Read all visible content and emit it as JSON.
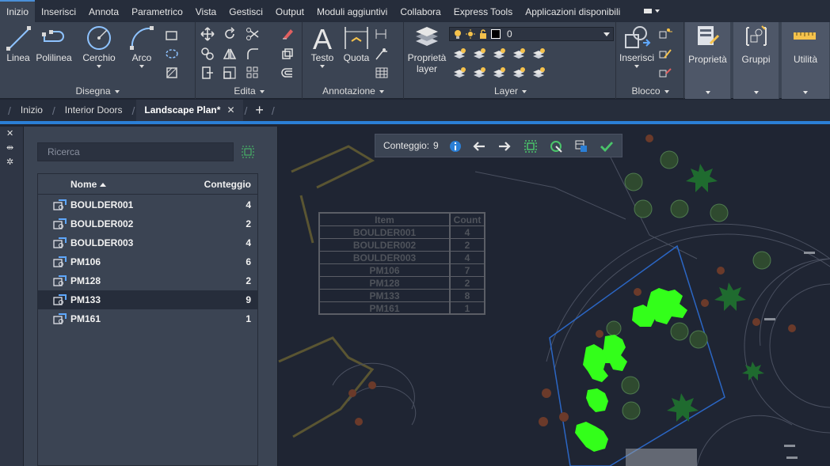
{
  "ribbon_tabs": [
    "Inizio",
    "Inserisci",
    "Annota",
    "Parametrico",
    "Vista",
    "Gestisci",
    "Output",
    "Moduli aggiuntivi",
    "Collabora",
    "Express Tools",
    "Applicazioni disponibili"
  ],
  "active_ribbon_tab": "Inizio",
  "panels": {
    "disegna": {
      "title": "Disegna",
      "linea": "Linea",
      "polilinea": "Polilinea",
      "cerchio": "Cerchio",
      "arco": "Arco"
    },
    "edita": {
      "title": "Edita"
    },
    "annotazione": {
      "title": "Annotazione",
      "testo": "Testo",
      "quota": "Quota"
    },
    "layer": {
      "title": "Layer",
      "proprieta_layer_line1": "Proprietà",
      "proprieta_layer_line2": "layer",
      "current_layer": "0"
    },
    "blocco": {
      "title": "Blocco",
      "inserisci": "Inserisci"
    },
    "proprieta": "Proprietà",
    "gruppi": "Gruppi",
    "utilita": "Utilità"
  },
  "file_tabs": {
    "inizio": "Inizio",
    "interior_doors": "Interior Doors",
    "landscape_plan": "Landscape Plan*"
  },
  "palette": {
    "search_placeholder": "Ricerca",
    "col_name": "Nome",
    "col_count": "Conteggio",
    "rows": [
      {
        "name": "BOULDER001",
        "count": "4"
      },
      {
        "name": "BOULDER002",
        "count": "2"
      },
      {
        "name": "BOULDER003",
        "count": "4"
      },
      {
        "name": "PM106",
        "count": "6"
      },
      {
        "name": "PM128",
        "count": "2"
      },
      {
        "name": "PM133",
        "count": "9"
      },
      {
        "name": "PM161",
        "count": "1"
      }
    ],
    "selected_row": "PM133"
  },
  "count_toolbar": {
    "label": "Conteggio:",
    "value": "9"
  },
  "drawing_table": {
    "header_item": "Item",
    "header_count": "Count",
    "rows": [
      {
        "item": "BOULDER001",
        "count": "4"
      },
      {
        "item": "BOULDER002",
        "count": "2"
      },
      {
        "item": "BOULDER003",
        "count": "4"
      },
      {
        "item": "PM106",
        "count": "7"
      },
      {
        "item": "PM128",
        "count": "2"
      },
      {
        "item": "PM133",
        "count": "8"
      },
      {
        "item": "PM161",
        "count": "1"
      }
    ]
  },
  "colors": {
    "accent_blue": "#2b7fd6",
    "highlight_green": "#33ff1a",
    "ribbon_bg": "#3b4453",
    "canvas_bg": "#1f2533"
  }
}
